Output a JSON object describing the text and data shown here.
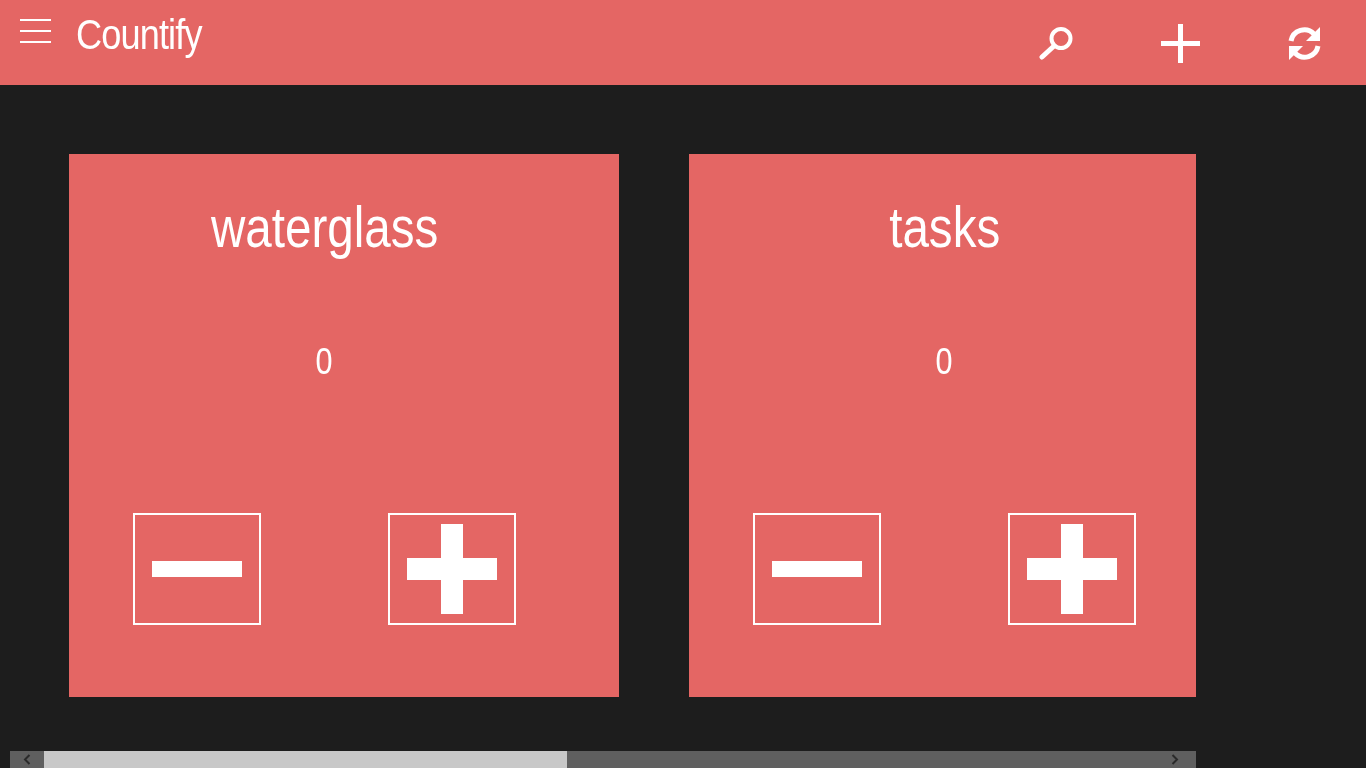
{
  "header": {
    "title": "Countify"
  },
  "counters": [
    {
      "name": "waterglass",
      "count": "0"
    },
    {
      "name": "tasks",
      "count": "0"
    }
  ]
}
